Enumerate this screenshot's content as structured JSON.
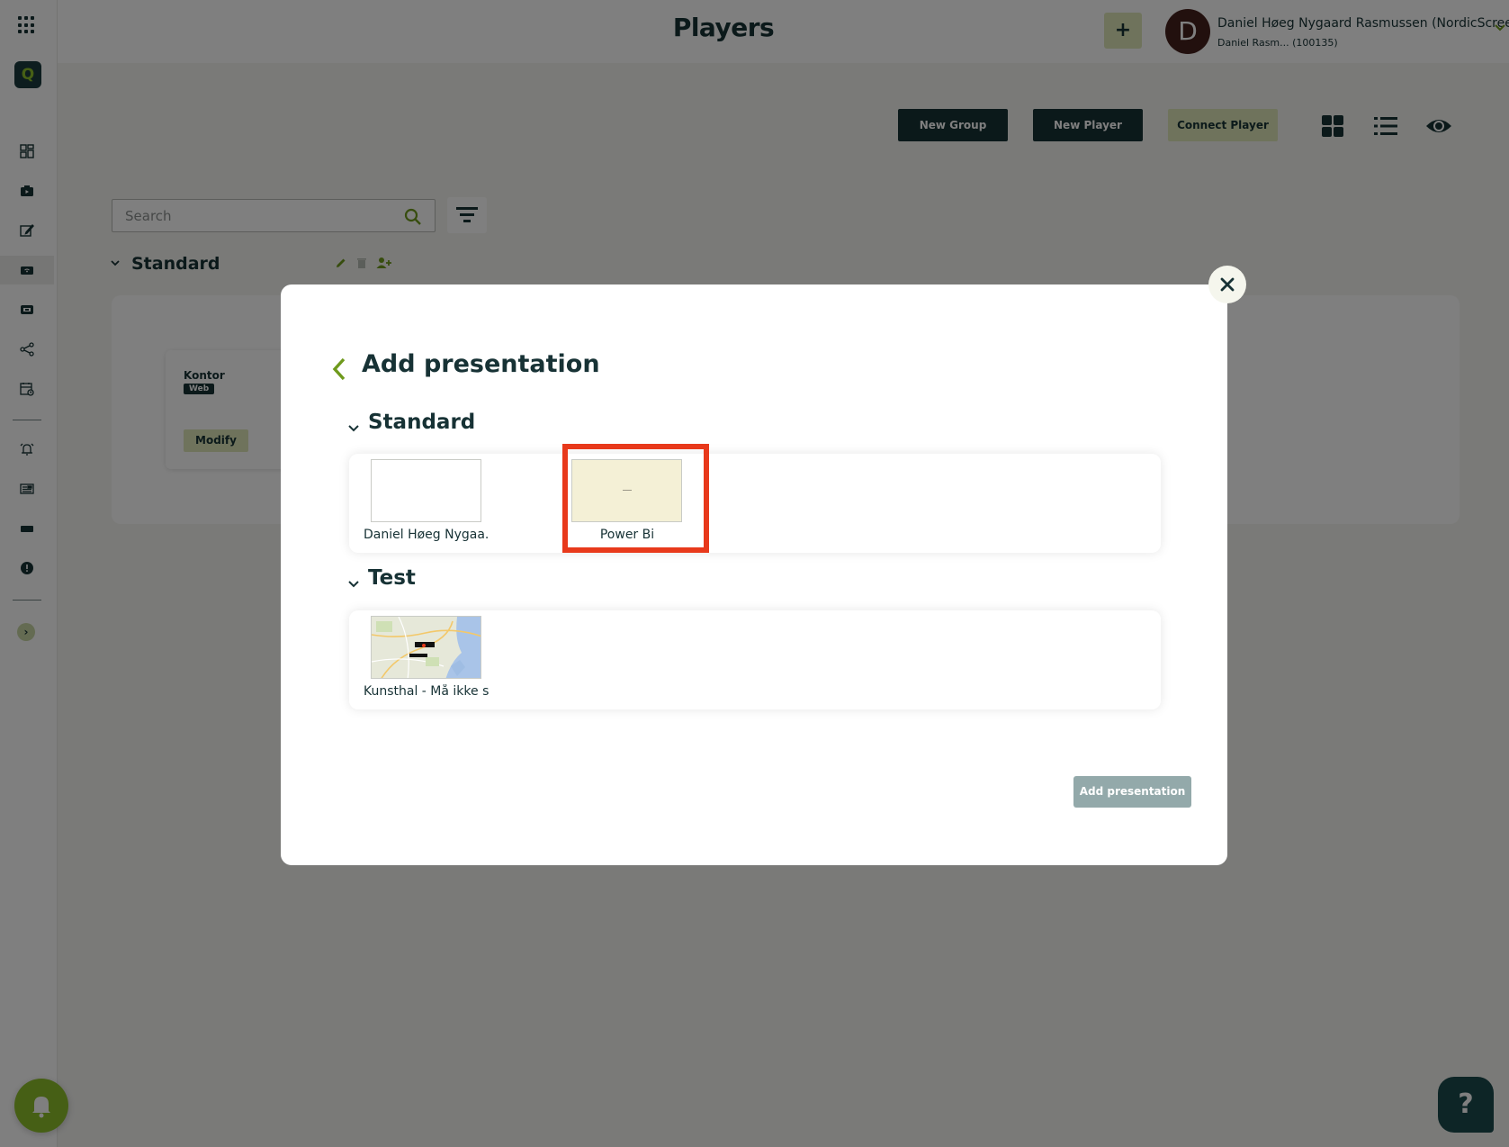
{
  "header": {
    "title": "Players",
    "add_label": "+",
    "avatar_initial": "D",
    "user_name": "Daniel Høeg Nygaard Rasmussen (NordicScreen)",
    "user_sub": "Daniel Rasm... (100135)"
  },
  "sidebar": {
    "logo": "Q",
    "expand": "›",
    "items": [
      {
        "icon": "dashboard-icon"
      },
      {
        "icon": "media-icon"
      },
      {
        "icon": "edit-icon"
      },
      {
        "icon": "players-icon",
        "active": true
      },
      {
        "icon": "screen-icon"
      },
      {
        "icon": "share-icon"
      },
      {
        "icon": "calendar-icon"
      },
      {
        "icon": "alarm-icon"
      },
      {
        "icon": "news-icon"
      },
      {
        "icon": "display-icon"
      },
      {
        "icon": "alert-icon"
      }
    ]
  },
  "toolbar": {
    "new_group": "New Group",
    "new_player": "New Player",
    "connect_player": "Connect Player",
    "views": [
      "grid-view-icon",
      "list-view-icon",
      "preview-eye-icon"
    ]
  },
  "search": {
    "placeholder": "Search",
    "value": ""
  },
  "group": {
    "title": "Standard",
    "player": {
      "name": "Kontor",
      "tag": "Web",
      "modify_label": "Modify"
    }
  },
  "modal": {
    "title": "Add presentation",
    "sections": [
      {
        "title": "Standard",
        "items": [
          {
            "label": "Daniel Høeg Nygaa...",
            "thumb": "blank"
          },
          {
            "label": "Power Bi",
            "thumb": "beige",
            "highlighted": true
          }
        ]
      },
      {
        "title": "Test",
        "items": [
          {
            "label": "Kunsthal - Må ikke s...",
            "thumb": "map"
          }
        ]
      }
    ],
    "add_button": "Add presentation"
  },
  "fabs": {
    "help_label": "?"
  },
  "colors": {
    "brand_dark": "#173235",
    "brand_lime": "#8cbf2a",
    "button_light": "#dfe7b8",
    "highlight": "#e8391b",
    "disabled_button": "#93a9aa"
  }
}
